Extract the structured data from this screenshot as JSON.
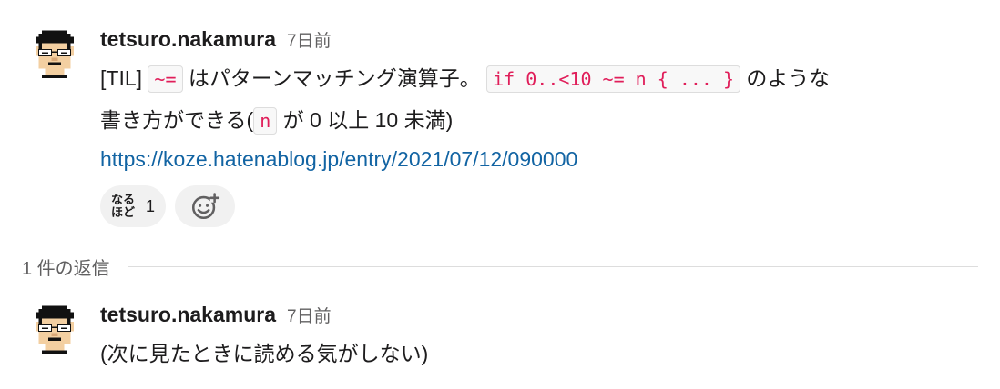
{
  "message1": {
    "author": "tetsuro.nakamura",
    "timestamp": "7日前",
    "text_prefix": "[TIL] ",
    "code1": "~=",
    "text_middle": " はパターンマッチング演算子。",
    "code2": "if 0..<10 ~= n { ... }",
    "text_line1_end": " のような",
    "text_line2_start": "書き方ができる(",
    "code3": "n",
    "text_end": " が 0 以上 10 未満)",
    "link": "https://koze.hatenablog.jp/entry/2021/07/12/090000",
    "reactions": [
      {
        "emoji_text_top": "なる",
        "emoji_text_bottom": "ほど",
        "count": "1"
      }
    ],
    "add_reaction_icon": "add-emoji-icon"
  },
  "replies": {
    "label": "1 件の返信"
  },
  "message2": {
    "author": "tetsuro.nakamura",
    "timestamp": "7日前",
    "text": "(次に見たときに読める気がしない)"
  },
  "colors": {
    "link": "#1264a3",
    "code": "#e01e5a",
    "reaction_bg": "#f1f1f1"
  }
}
